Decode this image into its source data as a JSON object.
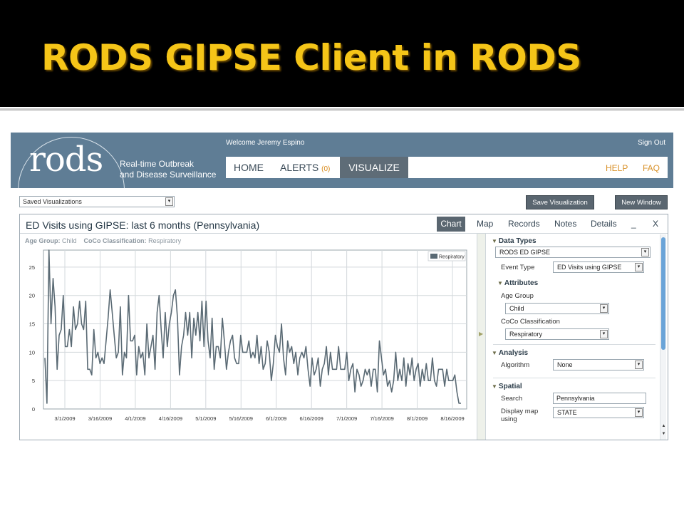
{
  "slide": {
    "title": "RODS GIPSE Client in RODS"
  },
  "header": {
    "logo_text": "rods",
    "tagline_1": "Real-time Outbreak",
    "tagline_2": "and Disease Surveillance",
    "welcome": "Welcome Jeremy Espino",
    "signout": "Sign Out",
    "colors": {
      "header_bg": "#5f7d95",
      "active_tab": "#5e6c77",
      "alerts_count": "#d98a1a",
      "help_link": "#d9922a"
    }
  },
  "nav": {
    "home": "HOME",
    "alerts": "ALERTS",
    "alerts_count": "(0)",
    "visualize": "VISUALIZE",
    "help": "HELP",
    "faq": "FAQ"
  },
  "toolbar": {
    "saved_select": "Saved Visualizations",
    "save_button": "Save Visualization",
    "new_window_button": "New Window"
  },
  "panel": {
    "title": "ED Visits using GIPSE: last 6 months (Pennsylvania)",
    "tabs": [
      "Chart",
      "Map",
      "Records",
      "Notes",
      "Details",
      "_",
      "X"
    ],
    "filter_age_label": "Age Group:",
    "filter_age_value": "Child",
    "filter_coco_label": "CoCo Classification:",
    "filter_coco_value": "Respiratory"
  },
  "sidebar": {
    "data_types": "Data Types",
    "data_source": "RODS ED GIPSE",
    "event_type_label": "Event Type",
    "event_type_value": "ED Visits using GIPSE",
    "attributes": "Attributes",
    "age_group_label": "Age Group",
    "age_group_value": "Child",
    "coco_label": "CoCo Classification",
    "coco_value": "Respiratory",
    "analysis": "Analysis",
    "algorithm_label": "Algorithm",
    "algorithm_value": "None",
    "spatial": "Spatial",
    "search_label": "Search",
    "search_value": "Pennsylvania",
    "display_map_label_1": "Display map",
    "display_map_label_2": "using",
    "display_map_value": "STATE"
  },
  "chart_data": {
    "type": "line",
    "series": [
      {
        "name": "Respiratory",
        "color": "#5a6a74",
        "values": [
          9,
          1,
          28,
          15,
          23,
          18,
          7,
          13,
          14,
          20,
          11,
          11,
          14,
          11,
          18,
          14,
          15,
          19,
          15,
          14,
          19,
          7,
          7,
          6,
          14,
          9,
          10,
          8,
          9,
          8,
          12,
          16,
          21,
          17,
          13,
          9,
          10,
          18,
          6,
          10,
          9,
          20,
          12,
          12,
          13,
          6,
          11,
          9,
          10,
          6,
          15,
          9,
          11,
          13,
          7,
          17,
          20,
          14,
          9,
          17,
          11,
          15,
          17,
          20,
          21,
          16,
          6,
          11,
          13,
          17,
          13,
          17,
          9,
          16,
          13,
          17,
          12,
          19,
          11,
          19,
          12,
          9,
          16,
          7,
          11,
          11,
          9,
          16,
          12,
          7,
          10,
          12,
          13,
          9,
          8,
          8,
          13,
          10,
          10,
          10,
          12,
          9,
          10,
          9,
          13,
          8,
          11,
          7,
          8,
          12,
          10,
          5,
          8,
          13,
          11,
          10,
          15,
          9,
          6,
          12,
          10,
          11,
          8,
          10,
          6,
          9,
          10,
          9,
          11,
          7,
          4,
          9,
          6,
          7,
          9,
          4,
          7,
          8,
          11,
          6,
          10,
          7,
          7,
          7,
          11,
          7,
          7,
          7,
          10,
          5,
          7,
          8,
          3,
          7,
          6,
          4,
          5,
          7,
          6,
          7,
          4,
          7,
          7,
          3,
          12,
          9,
          6,
          7,
          4,
          5,
          3,
          5,
          10,
          5,
          7,
          5,
          9,
          4,
          8,
          6,
          9,
          5,
          7,
          8,
          4,
          7,
          5,
          8,
          5,
          5,
          9,
          5,
          4,
          7,
          7,
          7,
          4,
          7,
          5,
          5,
          5,
          6,
          3,
          1,
          1
        ]
      }
    ],
    "x_tick_labels": [
      "3/1/2009",
      "3/16/2009",
      "4/1/2009",
      "4/16/2009",
      "5/1/2009",
      "5/16/2009",
      "6/1/2009",
      "6/16/2009",
      "7/1/2009",
      "7/16/2009",
      "8/1/2009",
      "8/16/2009"
    ],
    "y_ticks": [
      0,
      5,
      10,
      15,
      20,
      25
    ],
    "ylim": [
      0,
      28
    ],
    "grid": true,
    "legend_position": "top-right"
  }
}
